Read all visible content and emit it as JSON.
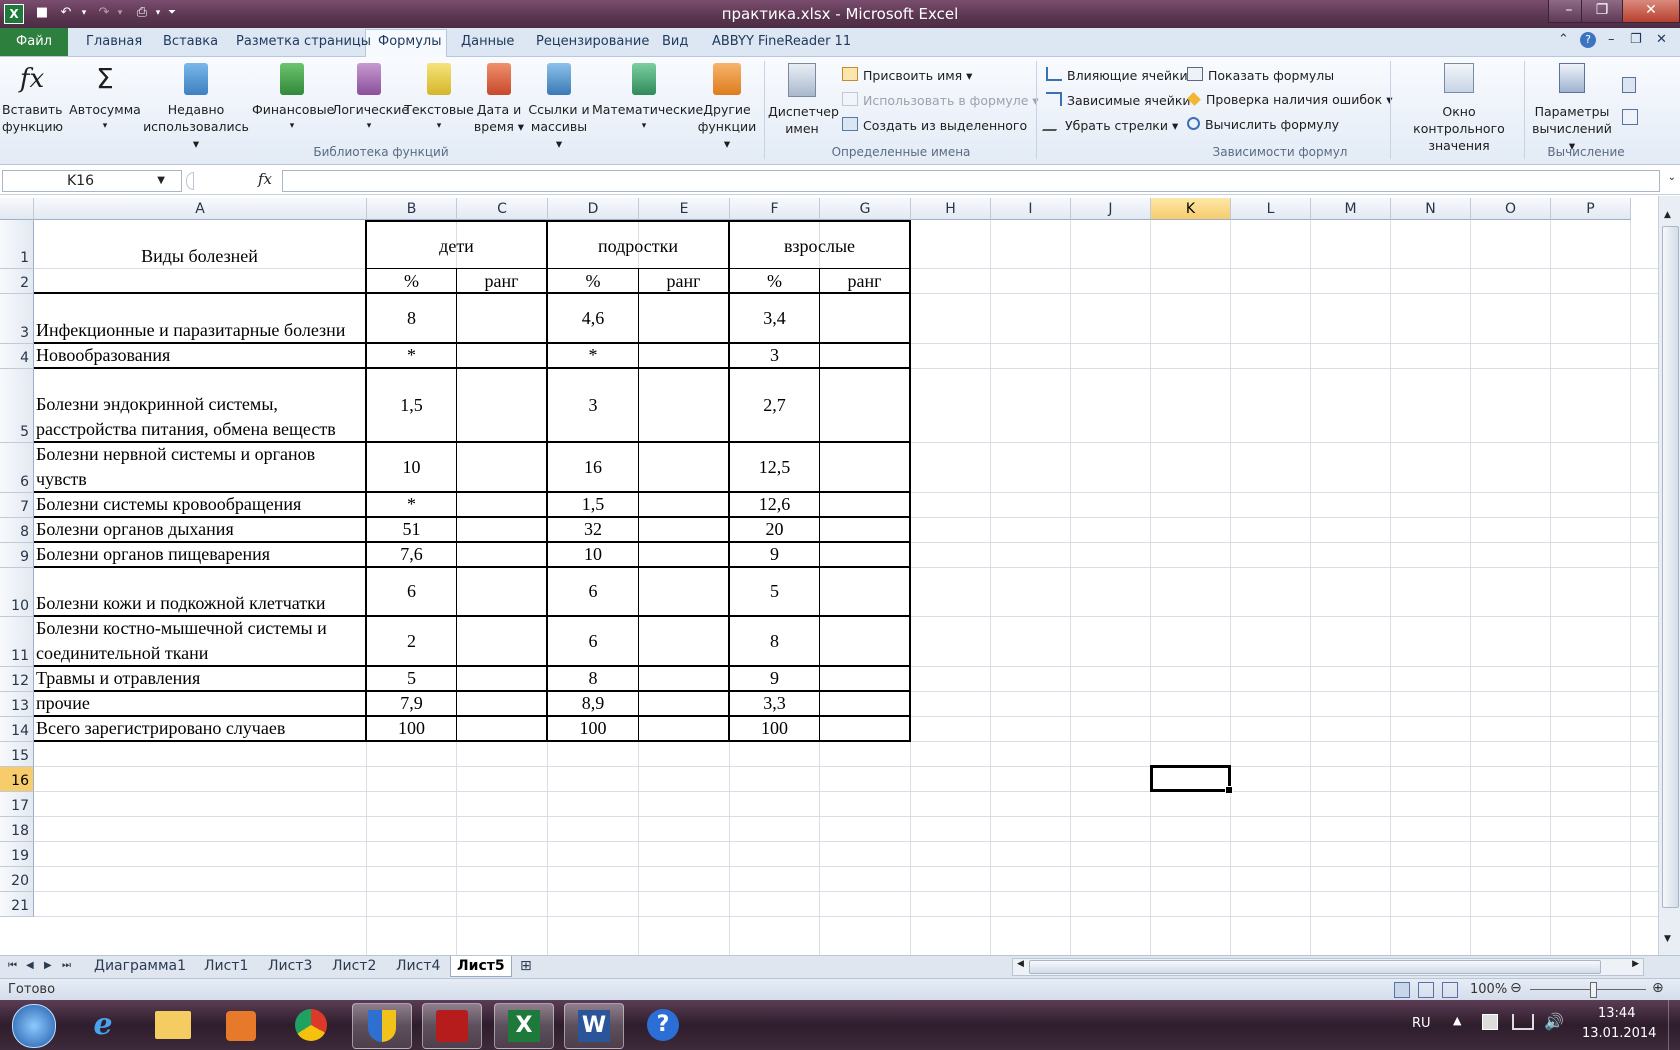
{
  "window": {
    "title": "практика.xlsx  -  Microsoft Excel",
    "app_icon_letter": "X",
    "controls": {
      "minimize": "–",
      "maximize": "❐",
      "close": "✕"
    }
  },
  "ribbon_tabs": {
    "file": "Файл",
    "items": [
      "Главная",
      "Вставка",
      "Разметка страницы",
      "Формулы",
      "Данные",
      "Рецензирование",
      "Вид",
      "ABBYY FineReader 11"
    ],
    "active": "Формулы"
  },
  "ribbon": {
    "function_library": {
      "label": "Библиотека функций",
      "insert_function": [
        "Вставить",
        "функцию"
      ],
      "autosum": [
        "Автосумма",
        "▾"
      ],
      "recent": [
        "Недавно",
        "использовались ▾"
      ],
      "financial": [
        "Финансовые",
        "▾"
      ],
      "logical": [
        "Логические",
        "▾"
      ],
      "text": [
        "Текстовые",
        "▾"
      ],
      "datetime": [
        "Дата и",
        "время ▾"
      ],
      "lookup": [
        "Ссылки и",
        "массивы ▾"
      ],
      "math": [
        "Математические",
        "▾"
      ],
      "other": [
        "Другие",
        "функции ▾"
      ]
    },
    "defined_names": {
      "label": "Определенные имена",
      "manager": [
        "Диспетчер",
        "имен"
      ],
      "define_name": "Присвоить имя ▾",
      "use_in_formula": "Использовать в формуле ▾",
      "create_from_selection": "Создать из выделенного"
    },
    "formula_auditing": {
      "label": "Зависимости формул",
      "trace_precedents": "Влияющие ячейки",
      "trace_dependents": "Зависимые ячейки",
      "remove_arrows": "Убрать стрелки ▾",
      "show_formulas": "Показать формулы",
      "error_checking": "Проверка наличия ошибок ▾",
      "evaluate_formula": "Вычислить формулу",
      "watch_window": [
        "Окно контрольного",
        "значения"
      ]
    },
    "calculation": {
      "label": "Вычисление",
      "options": [
        "Параметры",
        "вычислений ▾"
      ]
    }
  },
  "formula_bar": {
    "name_box": "K16",
    "fx": "fx",
    "content": ""
  },
  "columns": [
    "A",
    "B",
    "C",
    "D",
    "E",
    "F",
    "G",
    "H",
    "I",
    "J",
    "K",
    "L",
    "M",
    "N",
    "O",
    "P"
  ],
  "active_column": "K",
  "rows": [
    "1",
    "2",
    "3",
    "4",
    "5",
    "6",
    "7",
    "8",
    "9",
    "10",
    "11",
    "12",
    "13",
    "14",
    "15",
    "16",
    "17",
    "18",
    "19",
    "20",
    "21"
  ],
  "active_row": "16",
  "table": {
    "header": {
      "title": "Виды болезней",
      "groups": [
        "дети",
        "подростки",
        "взрослые"
      ],
      "subheaders": [
        "%",
        "ранг",
        "%",
        "ранг",
        "%",
        "ранг"
      ]
    },
    "body": [
      {
        "name": "Инфекционные и паразитарные болезни",
        "b": "8",
        "d": "4,6",
        "f": "3,4"
      },
      {
        "name": "Новообразования",
        "b": "*",
        "d": "*",
        "f": "3"
      },
      {
        "name": "Болезни эндокринной системы, расстройства питания, обмена веществ",
        "b": "1,5",
        "d": "3",
        "f": "2,7"
      },
      {
        "name": "Болезни нервной системы и органов чувств",
        "b": "10",
        "d": "16",
        "f": "12,5"
      },
      {
        "name": "Болезни системы кровообращения",
        "b": "*",
        "d": "1,5",
        "f": "12,6"
      },
      {
        "name": "Болезни органов дыхания",
        "b": "51",
        "d": "32",
        "f": "20"
      },
      {
        "name": "Болезни органов пищеварения",
        "b": "7,6",
        "d": "10",
        "f": "9"
      },
      {
        "name": "Болезни кожи и подкожной клетчатки",
        "b": "6",
        "d": "6",
        "f": "5"
      },
      {
        "name": "Болезни костно-мышечной системы и соединительной ткани",
        "b": "2",
        "d": "6",
        "f": "8"
      },
      {
        "name": "Травмы и отравления",
        "b": "5",
        "d": "8",
        "f": "9"
      },
      {
        "name": "прочие",
        "b": "7,9",
        "d": "8,9",
        "f": "3,3"
      },
      {
        "name": "Всего зарегистрировано случаев",
        "b": "100",
        "d": "100",
        "f": "100"
      }
    ]
  },
  "sheets": {
    "tabs": [
      "Диаграмма1",
      "Лист1",
      "Лист3",
      "Лист2",
      "Лист4",
      "Лист5"
    ],
    "active": "Лист5"
  },
  "status": {
    "ready": "Готово",
    "zoom": "100%"
  },
  "taskbar": {
    "lang": "RU",
    "time": "13:44",
    "date": "13.01.2014"
  },
  "colors": {
    "file_tab": "#2d7f3e",
    "title_bar": "#5a3550",
    "selection_header": "#f7cc6d"
  }
}
